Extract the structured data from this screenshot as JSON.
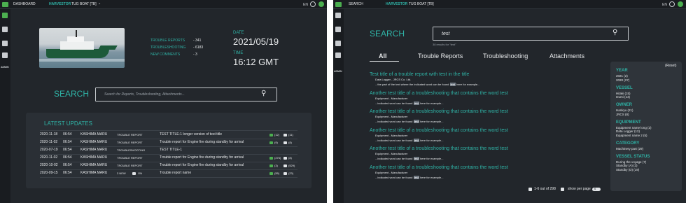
{
  "left": {
    "topbar": {
      "section": "DASHBOARD",
      "app_name": "HARVESTOR",
      "vessel": "TUG BOAT [TB]",
      "lang": "EN"
    },
    "sidebar": {
      "admin_label": "ADMIN"
    },
    "stats": {
      "trouble_reports_label": "TROUBLE REPORTS",
      "trouble_reports_value": "- 341",
      "troubleshooting_label": "TROUBLESHOOTING",
      "troubleshooting_value": "- 6183",
      "new_comments_label": "NEW COMMENTS",
      "new_comments_value": "- 3"
    },
    "date": {
      "label": "DATE",
      "value": "2021/05/19"
    },
    "time": {
      "label": "TIME",
      "value": "16:12 GMT"
    },
    "search": {
      "title": "SEARCH",
      "placeholder": "Search for Reports, Troubleshooting, Attachments..."
    },
    "updates": {
      "title": "LATEST UPDATES",
      "rows": [
        {
          "date": "2020-11-18",
          "time": "06:54",
          "vessel": "KASHIMA MARU",
          "type": "TROUBLE REPORT",
          "title": "TEST TITLE-1 longer version of test title",
          "likes": "(12)",
          "comments": "(11)"
        },
        {
          "date": "2020-11-02",
          "time": "06:54",
          "vessel": "KASHIMA MARU",
          "type": "TROUBLE REPORT",
          "title": "Trouble report for Engine fire during standby for arrival",
          "likes": "(9)",
          "comments": "(8)"
        },
        {
          "date": "2020-07-19",
          "time": "06:54",
          "vessel": "KASHIMA MARU",
          "type": "TROUBLESHOOTING",
          "title": "TEST TITLE-1",
          "likes": "",
          "comments": ""
        },
        {
          "date": "2020-11-02",
          "time": "06:54",
          "vessel": "KASHIMA MARU",
          "type": "TROUBLE REPORT",
          "title": "Trouble report for Engine fire during standby for arrival",
          "likes": "(276)",
          "comments": "(8)"
        },
        {
          "date": "2020-10-02",
          "time": "06:54",
          "vessel": "KASHIMA MARU",
          "type": "TROUBLE REPORT",
          "title": "Trouble report for Engine fire during standby for arrival",
          "likes": "(3)",
          "comments": "(529)"
        },
        {
          "date": "2020-09-15",
          "time": "06:54",
          "vessel": "KASHIMA MARU",
          "type": "3 NEW",
          "type_extra": "ON",
          "title": "Trouble report name",
          "likes": "(55)",
          "comments": "(23)"
        }
      ]
    }
  },
  "right": {
    "topbar": {
      "section": "SEARCH",
      "app_name": "HARVESTOR",
      "vessel": "TUG BOAT [TB]",
      "lang": "EN"
    },
    "sidebar": {
      "admin_label": "ADMIN"
    },
    "search": {
      "title": "SEARCH",
      "query": "test",
      "result_count": "38 results for \"test\""
    },
    "tabs": [
      "All",
      "Trouble Reports",
      "Troubleshooting",
      "Attachments"
    ],
    "results": [
      {
        "title": "Test title of a trouble report with test in the title",
        "meta": "Data Logger - JRCS Co. Ltd.",
        "snippet_pre": "...the part of the text where the indicated word can be found",
        "snippet_hl": "test",
        "snippet_post": "here for example..."
      },
      {
        "title": "Another test title of a troubleshooting that contains the word test",
        "meta": "Equipment - Manufacturer",
        "snippet_pre": "...indicated word can be found",
        "snippet_hl": "test",
        "snippet_post": "here for example..."
      },
      {
        "title": "Another test title of a troubleshooting that contains the word test",
        "meta": "Equipment - Manufacturer",
        "snippet_pre": "...indicated word can be found",
        "snippet_hl": "test",
        "snippet_post": "here for example..."
      },
      {
        "title": "Another test title of a troubleshooting that contains the word test",
        "meta": "Equipment - Manufacturer",
        "snippet_pre": "...indicated word can be found",
        "snippet_hl": "test",
        "snippet_post": "here for example..."
      },
      {
        "title": "Another test title of a troubleshooting that contains the word test",
        "meta": "Equipment - Manufacturer",
        "snippet_pre": "...indicated word can be found",
        "snippet_hl": "test",
        "snippet_post": "here for example..."
      },
      {
        "title": "Another test title of a troubleshooting that contains the word test",
        "meta": "Equipment - Manufacturer",
        "snippet_pre": "...indicated word can be found",
        "snippet_hl": "test",
        "snippet_post": "here for example..."
      }
    ],
    "pagination": {
      "range": "1-6 out of 298",
      "per_page_label": "show per page",
      "per_page_value": "6"
    },
    "filters": {
      "reset": "(Reset)",
      "year": {
        "title": "YEAR",
        "items": [
          "2021 (2)",
          "2020 (27)"
        ]
      },
      "vessel": {
        "title": "VESSEL",
        "items": [
          "Hitaki (15)",
          "Izumi (14)"
        ]
      },
      "owner": {
        "title": "OWNER",
        "items": [
          "Hankyu (21)",
          "JRCS (8)"
        ]
      },
      "equipment": {
        "title": "EQUIPMENT",
        "items": [
          "Equipment name long (2)",
          "Data Logger (12)",
          "Equipment name 2 (5)"
        ]
      },
      "category": {
        "title": "CATEGORY",
        "items": [
          "Machinery part (29)"
        ]
      },
      "vessel_status": {
        "title": "VESSEL STATUS",
        "items": [
          "During the voyage (7)",
          "Standby (A) (3)",
          "Standby (D) (19)"
        ]
      }
    },
    "colors": {
      "accent": "#2fb3a6",
      "brand": "#4caf50",
      "background": "#22262b"
    }
  }
}
